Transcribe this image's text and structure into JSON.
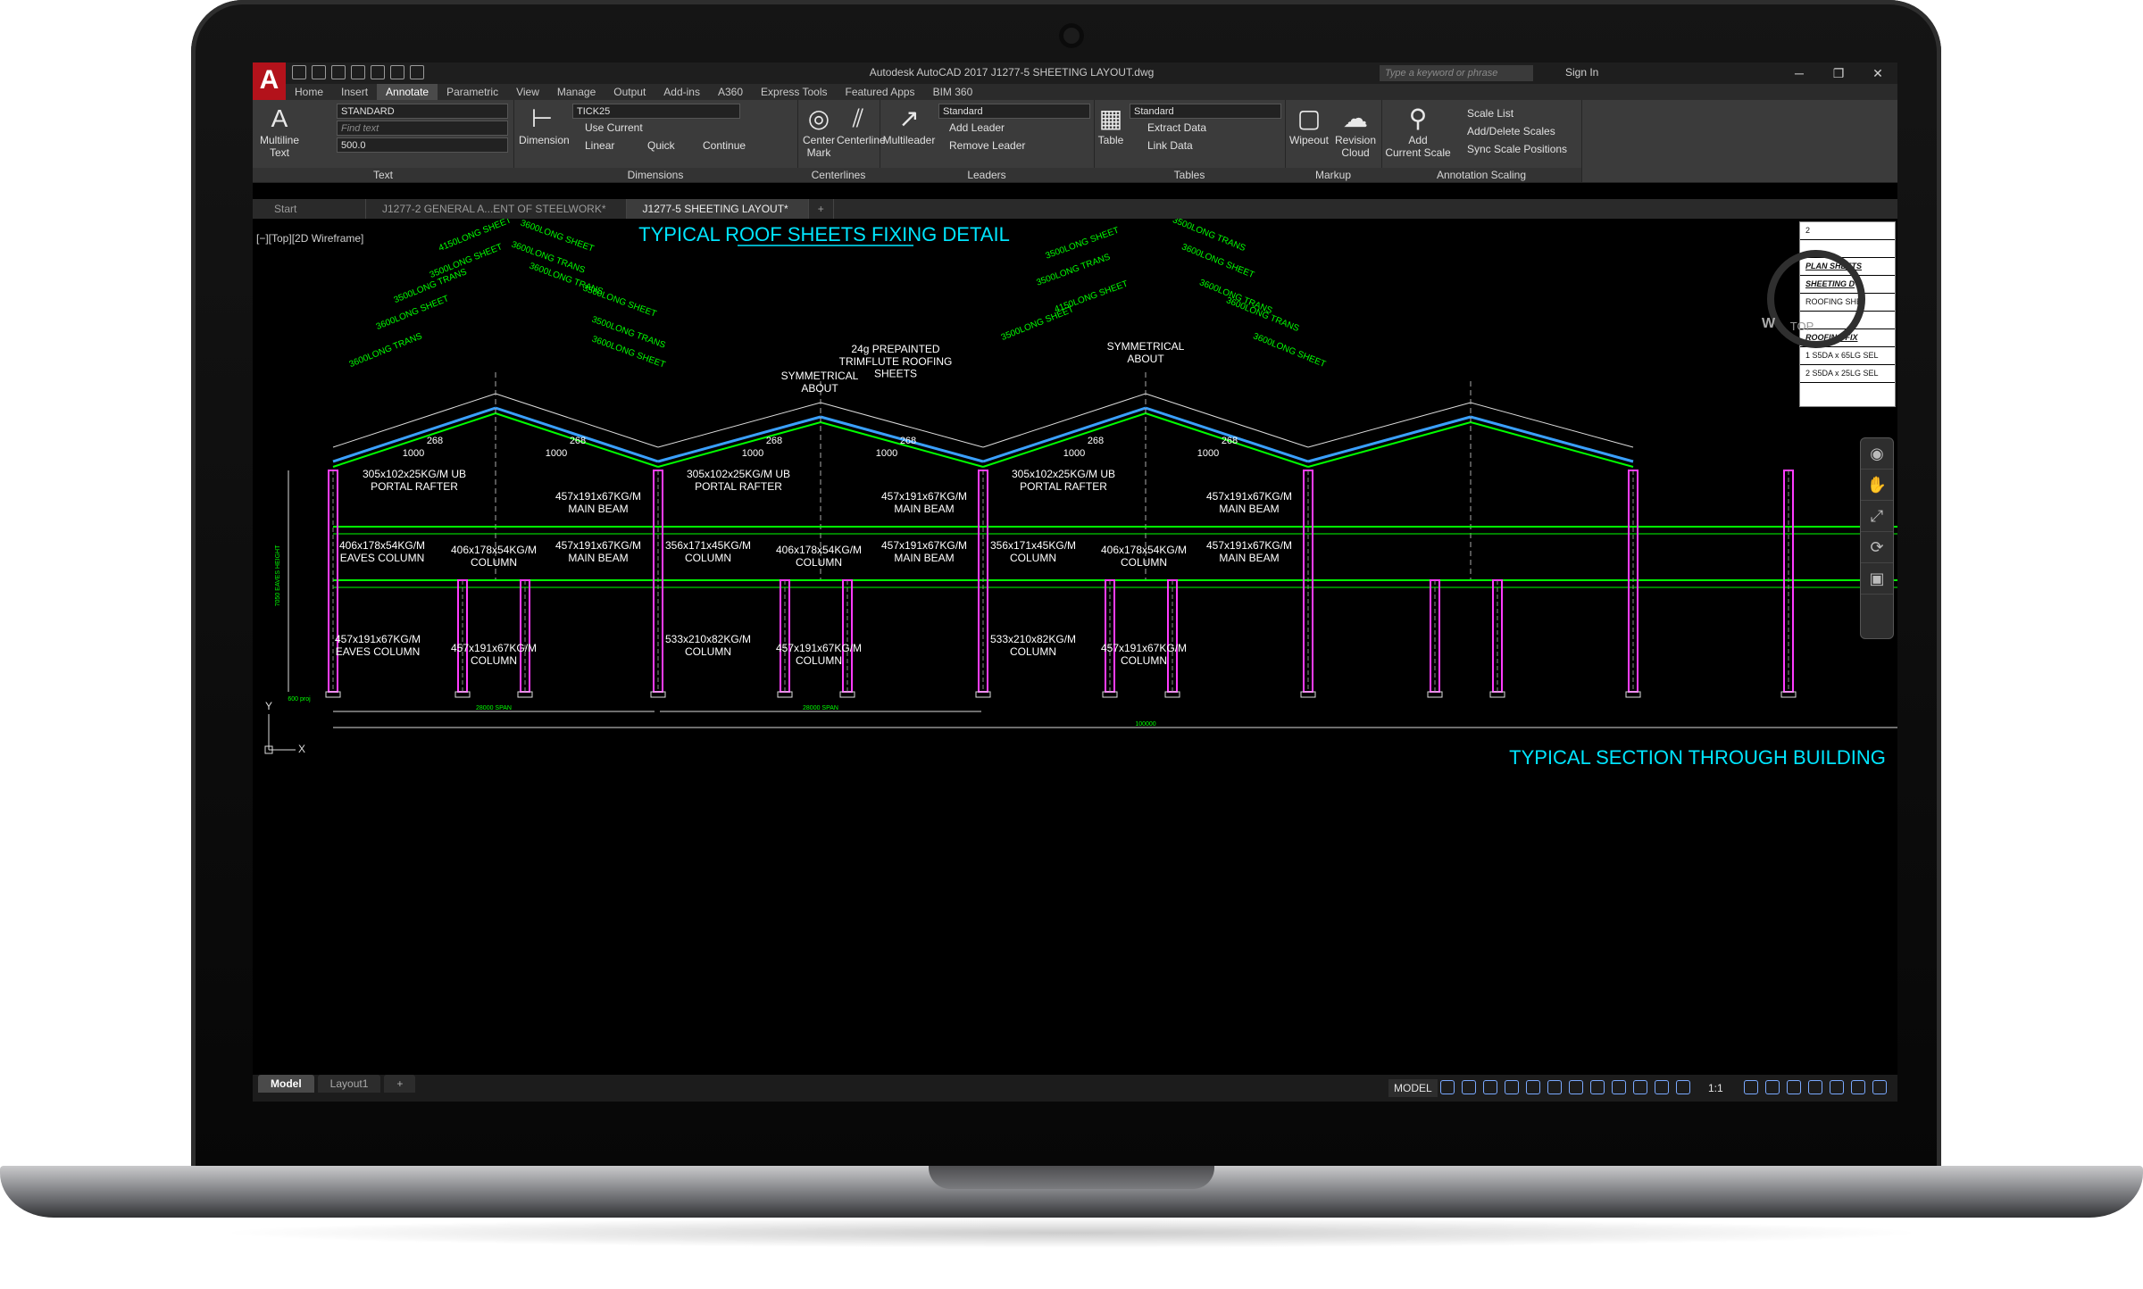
{
  "titlebar": {
    "app_title": "Autodesk AutoCAD 2017   J1277-5  SHEETING LAYOUT.dwg",
    "search_placeholder": "Type a keyword or phrase",
    "sign_in": "Sign In",
    "min": "─",
    "max": "❐",
    "close": "✕"
  },
  "ribbon_tabs": [
    "Home",
    "Insert",
    "Annotate",
    "Parametric",
    "View",
    "Manage",
    "Output",
    "Add-ins",
    "A360",
    "Express Tools",
    "Featured Apps",
    "BIM 360"
  ],
  "ribbon": {
    "text": {
      "multiline": "Multiline\nText",
      "style": "STANDARD",
      "find": "Find text",
      "height": "500.0",
      "title": "Text"
    },
    "dimensions": {
      "dimension": "Dimension",
      "style": "TICK25",
      "use_current": "Use Current",
      "linear": "Linear",
      "quick": "Quick",
      "continue": "Continue",
      "title": "Dimensions"
    },
    "centerlines": {
      "center_mark": "Center\nMark",
      "centerline": "Centerline",
      "title": "Centerlines"
    },
    "leaders": {
      "multileader": "Multileader",
      "style": "Standard",
      "add": "Add Leader",
      "remove": "Remove Leader",
      "title": "Leaders"
    },
    "tables": {
      "table": "Table",
      "style": "Standard",
      "extract": "Extract Data",
      "link": "Link Data",
      "title": "Tables"
    },
    "markup": {
      "wipeout": "Wipeout",
      "revision": "Revision\nCloud",
      "title": "Markup"
    },
    "annotation_scaling": {
      "add_current": "Add\nCurrent Scale",
      "scale_list": "Scale List",
      "add_delete": "Add/Delete Scales",
      "sync": "Sync Scale Positions",
      "title": "Annotation Scaling"
    }
  },
  "doc_tabs": [
    "Start",
    "J1277-2 GENERAL A...ENT OF STEELWORK*",
    "J1277-5  SHEETING LAYOUT*",
    "+"
  ],
  "viewport_label": "[−][Top][2D Wireframe]",
  "drawing": {
    "roof_title": "TYPICAL ROOF SHEETS FIXING DETAIL",
    "section_title": "TYPICAL SECTION THROUGH BUILDING",
    "sheet_labels": [
      "3600LONG TRANS",
      "3600LONG SHEET",
      "3500LONG TRANS",
      "3500LONG SHEET",
      "4150LONG SHEET",
      "3500LONG SHEET",
      "3500LONG TRANS",
      "3600LONG SHEET",
      "3600LONG TRANS"
    ],
    "roofing_note": "24g PREPAINTED\nTRIMFLUTE ROOFING\nSHEETS",
    "symmetrical": "SYMMETRICAL\nABOUT",
    "pitch": [
      "268",
      "1000"
    ],
    "rafter": "305x102x25KG/M UB\nPORTAL RAFTER",
    "main_beam": "457x191x67KG/M\nMAIN BEAM",
    "eaves_col_top": "406x178x54KG/M\nEAVES COLUMN",
    "col_406": "406x178x54KG/M\nCOLUMN",
    "col_356": "356x171x45KG/M\nCOLUMN",
    "eaves_col_bot": "457x191x67KG/M\nEAVES COLUMN",
    "col_457": "457x191x67KG/M\nCOLUMN",
    "col_533": "533x210x82KG/M\nCOLUMN",
    "eaves_height": "7050 EAVES HEIGHT",
    "span": "28000 SPAN",
    "overall": "100000",
    "proj": "600 proj",
    "axis_x": "X",
    "axis_y": "Y"
  },
  "title_block": [
    "2",
    "",
    "PLAN SHEETS",
    "SHEETING D",
    "ROOFING SHE",
    "",
    "ROOFING FIX",
    "1   S5DA x 65LG SEL",
    "2   S5DA x 25LG SEL"
  ],
  "viewcube": {
    "top": "TOP",
    "w": "W"
  },
  "layout_tabs": [
    "Model",
    "Layout1",
    "+"
  ],
  "status": {
    "model": "MODEL",
    "scale": "1:1"
  },
  "colors": {
    "ribbon": "#3b3b3b",
    "canvas": "#000000",
    "steel": "#ff3cff",
    "purlin": "#00ff00",
    "roof": "#3aa0ff",
    "text": "#ffffff",
    "title": "#00e5ff",
    "dim": "#00ff00"
  }
}
